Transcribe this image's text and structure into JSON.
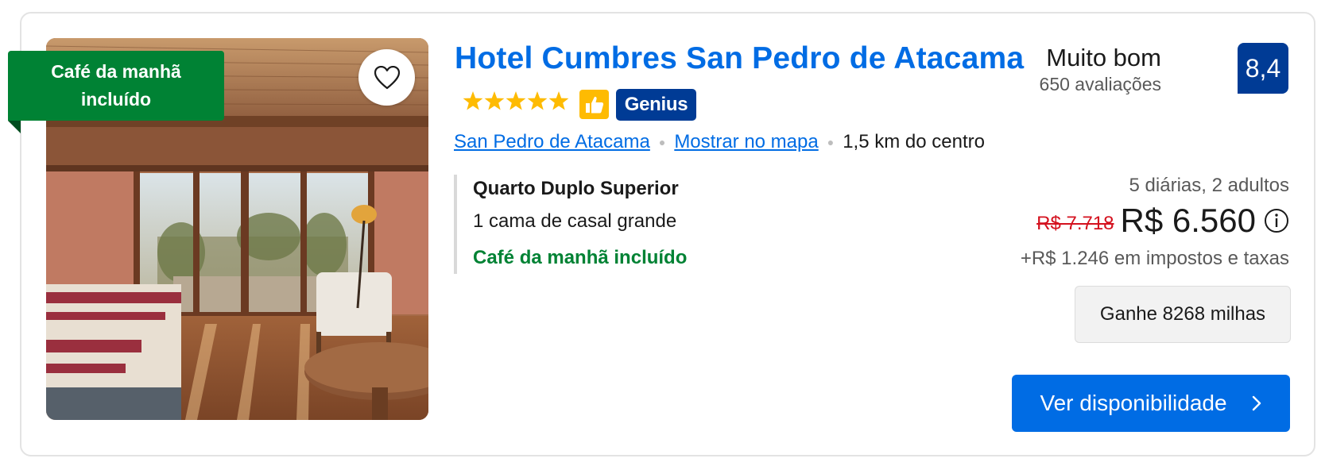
{
  "ribbon": {
    "text": "Café da manhã\nincluído"
  },
  "hotel": {
    "name": "Hotel Cumbres San Pedro de Atacama",
    "stars": 5,
    "genius_label": "Genius"
  },
  "location": {
    "city": "San Pedro de Atacama",
    "map_link": "Mostrar no mapa",
    "distance": "1,5 km do centro"
  },
  "room": {
    "name": "Quarto Duplo Superior",
    "bed": "1 cama de casal grande",
    "breakfast": "Café da manhã incluído"
  },
  "rating": {
    "word": "Muito bom",
    "reviews": "650 avaliações",
    "score": "8,4"
  },
  "price": {
    "stay": "5 diárias, 2 adultos",
    "original": "R$ 7.718",
    "current": "R$ 6.560",
    "taxes": "+R$ 1.246 em impostos e taxas"
  },
  "miles": {
    "label": "Ganhe 8268 milhas"
  },
  "cta": {
    "label": "Ver disponibilidade"
  },
  "colors": {
    "brand_blue": "#006ce4",
    "dark_blue": "#003b95",
    "green": "#008234",
    "star_yellow": "#febb02",
    "strike_red": "#d4111e"
  }
}
